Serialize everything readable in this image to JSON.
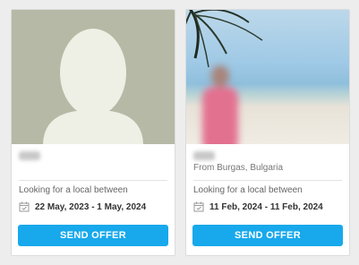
{
  "cards": [
    {
      "location": "",
      "looking_label": "Looking for a local between",
      "date_range": "22 May, 2023 - 1 May, 2024",
      "button_label": "SEND OFFER"
    },
    {
      "location": "From Burgas, Bulgaria",
      "looking_label": "Looking for a local between",
      "date_range": "11 Feb, 2024 - 11 Feb, 2024",
      "button_label": "SEND OFFER"
    }
  ],
  "colors": {
    "button": "#17a9ec",
    "placeholder_bg": "#b6b9a5",
    "avatar_fg": "#eef0e6"
  }
}
